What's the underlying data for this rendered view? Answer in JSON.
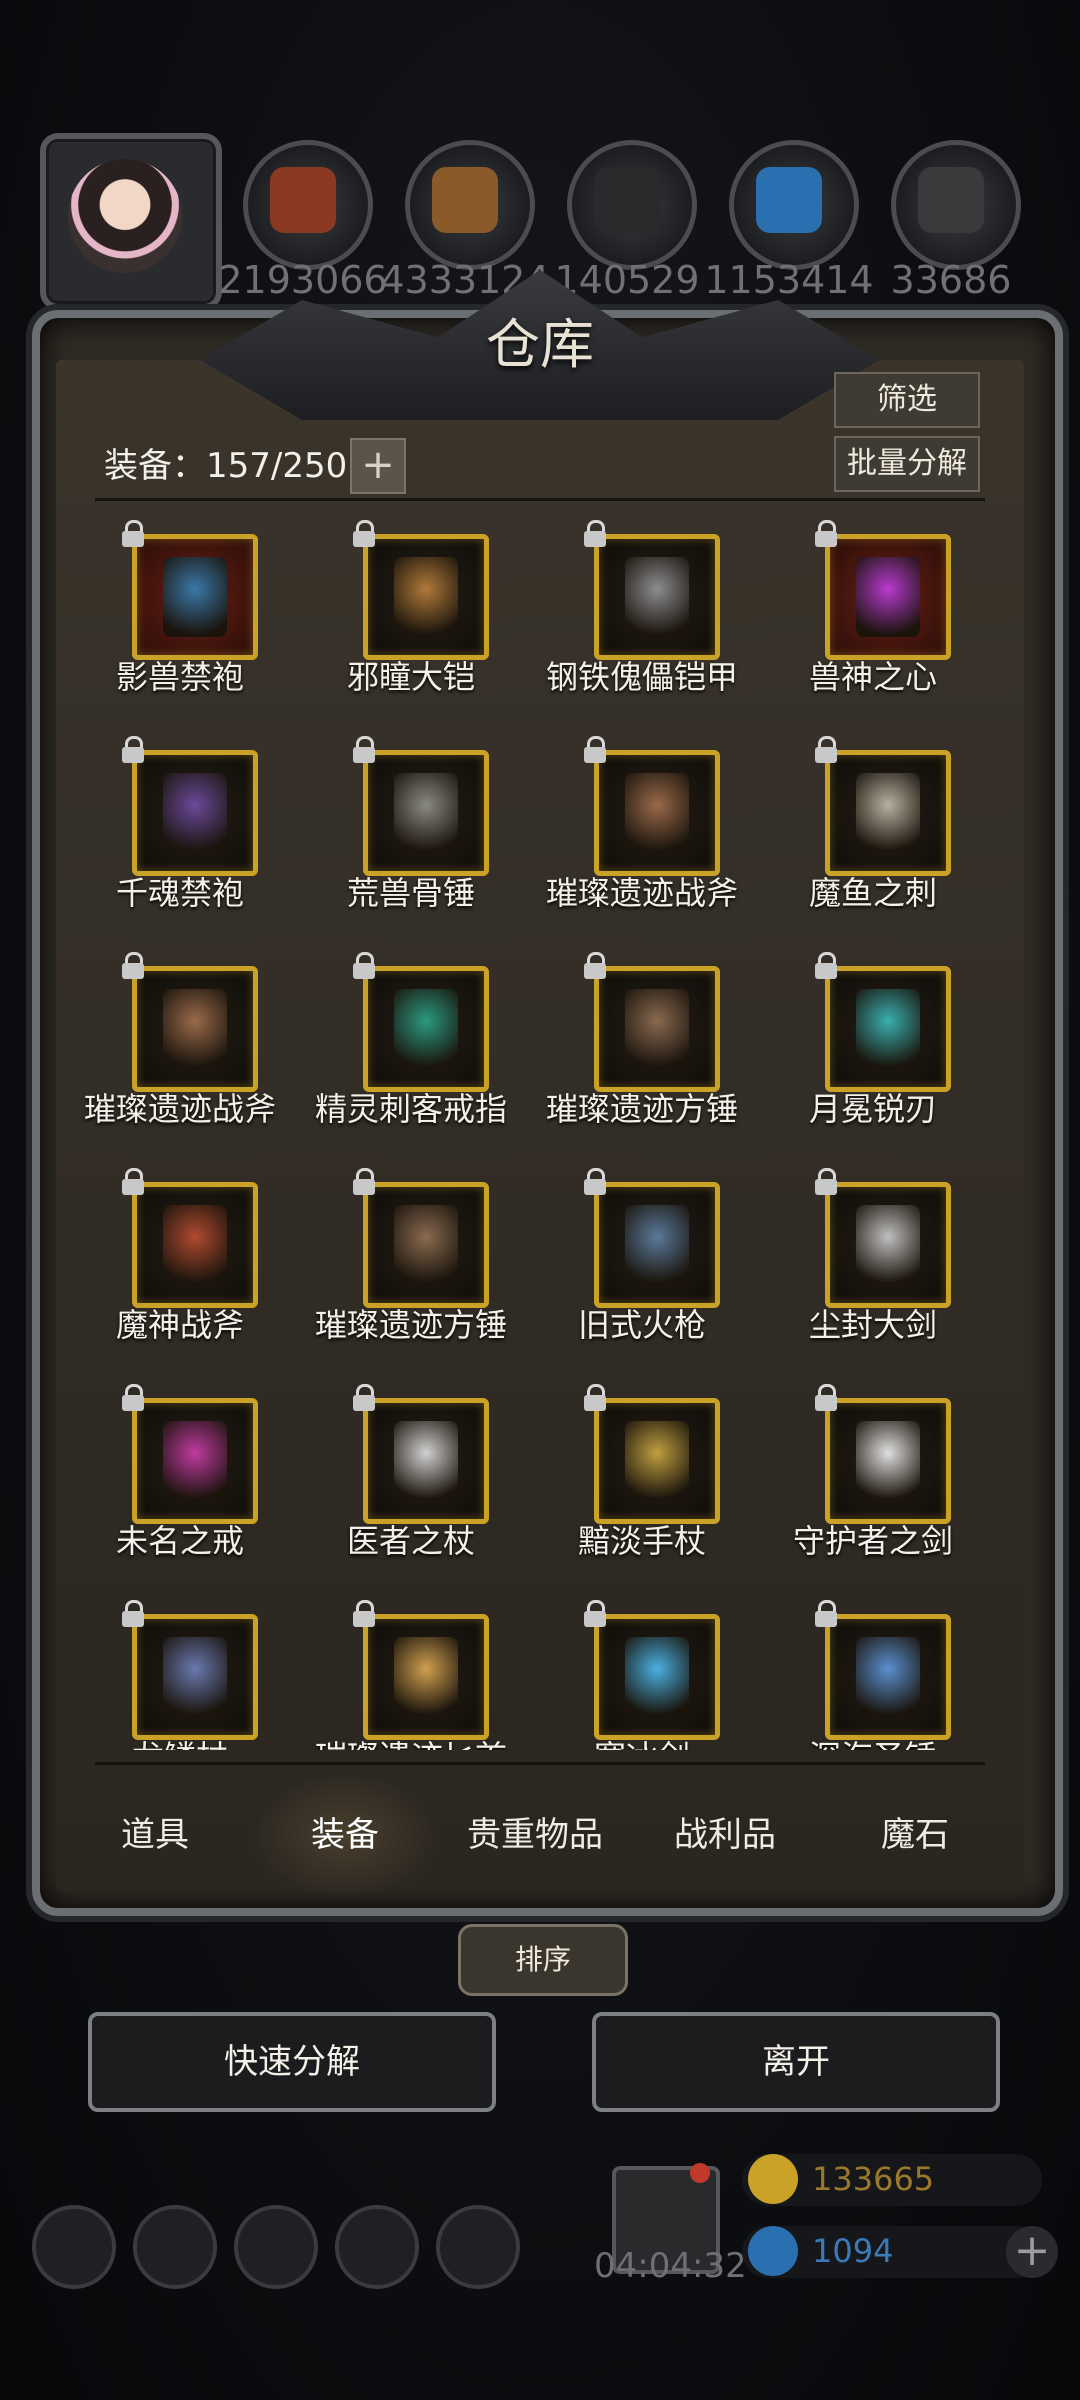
{
  "resources": [
    "2193066",
    "4333124",
    "140529",
    "1153414",
    "33686"
  ],
  "panel": {
    "title": "仓库",
    "capacity_label": "装备：157/250",
    "expand_icon": "plus-icon",
    "filter_label": "筛选",
    "batch_dismantle_label": "批量分解"
  },
  "items": [
    {
      "name": "影兽禁袍",
      "color": "#3a78a8",
      "red": true
    },
    {
      "name": "邪瞳大铠",
      "color": "#b07a3a",
      "red": false
    },
    {
      "name": "钢铁傀儡铠甲",
      "color": "#8c8c90",
      "red": false
    },
    {
      "name": "兽神之心",
      "color": "#b83ad0",
      "red": true
    },
    {
      "name": "千魂禁袍",
      "color": "#6a4a9a",
      "red": false
    },
    {
      "name": "荒兽骨锤",
      "color": "#8a8a80",
      "red": false
    },
    {
      "name": "璀璨遗迹战斧",
      "color": "#9a6a4a",
      "red": false
    },
    {
      "name": "魔鱼之刺",
      "color": "#b8b0a0",
      "red": false
    },
    {
      "name": "璀璨遗迹战斧",
      "color": "#9a6a4a",
      "red": false
    },
    {
      "name": "精灵刺客戒指",
      "color": "#2a9a80",
      "red": false
    },
    {
      "name": "璀璨遗迹方锤",
      "color": "#8a6a50",
      "red": false
    },
    {
      "name": "月冕锐刃",
      "color": "#3ab0b0",
      "red": false
    },
    {
      "name": "魔神战斧",
      "color": "#b04a30",
      "red": false
    },
    {
      "name": "璀璨遗迹方锤",
      "color": "#8a6a50",
      "red": false
    },
    {
      "name": "旧式火枪",
      "color": "#5a7a9a",
      "red": false
    },
    {
      "name": "尘封大剑",
      "color": "#c0c0c0",
      "red": false
    },
    {
      "name": "未名之戒",
      "color": "#c03aa0",
      "red": false
    },
    {
      "name": "医者之杖",
      "color": "#d0d0d0",
      "red": false
    },
    {
      "name": "黯淡手杖",
      "color": "#c0a040",
      "red": false
    },
    {
      "name": "守护者之剑",
      "color": "#e0e0e0",
      "red": false
    },
    {
      "name": "龙鳞杖",
      "color": "#6a7ab0",
      "red": false
    },
    {
      "name": "璀璨遗迹匕首",
      "color": "#d0a050",
      "red": false
    },
    {
      "name": "寒冰剑",
      "color": "#4ab0e0",
      "red": false
    },
    {
      "name": "深海圣锤",
      "color": "#5a90d0",
      "red": false
    }
  ],
  "tabs": {
    "items": "道具",
    "equipment": "装备",
    "valuables": "贵重物品",
    "loot": "战利品",
    "magic_stone": "魔石"
  },
  "sort_label": "排序",
  "quick_dismantle_label": "快速分解",
  "leave_label": "离开",
  "timer": "04:04:32",
  "gold": "133665",
  "gems": "1094",
  "colors": {
    "gold": "#c9a227",
    "gold_text": "#9a7a2a",
    "gem_text": "#3a7ab8"
  }
}
